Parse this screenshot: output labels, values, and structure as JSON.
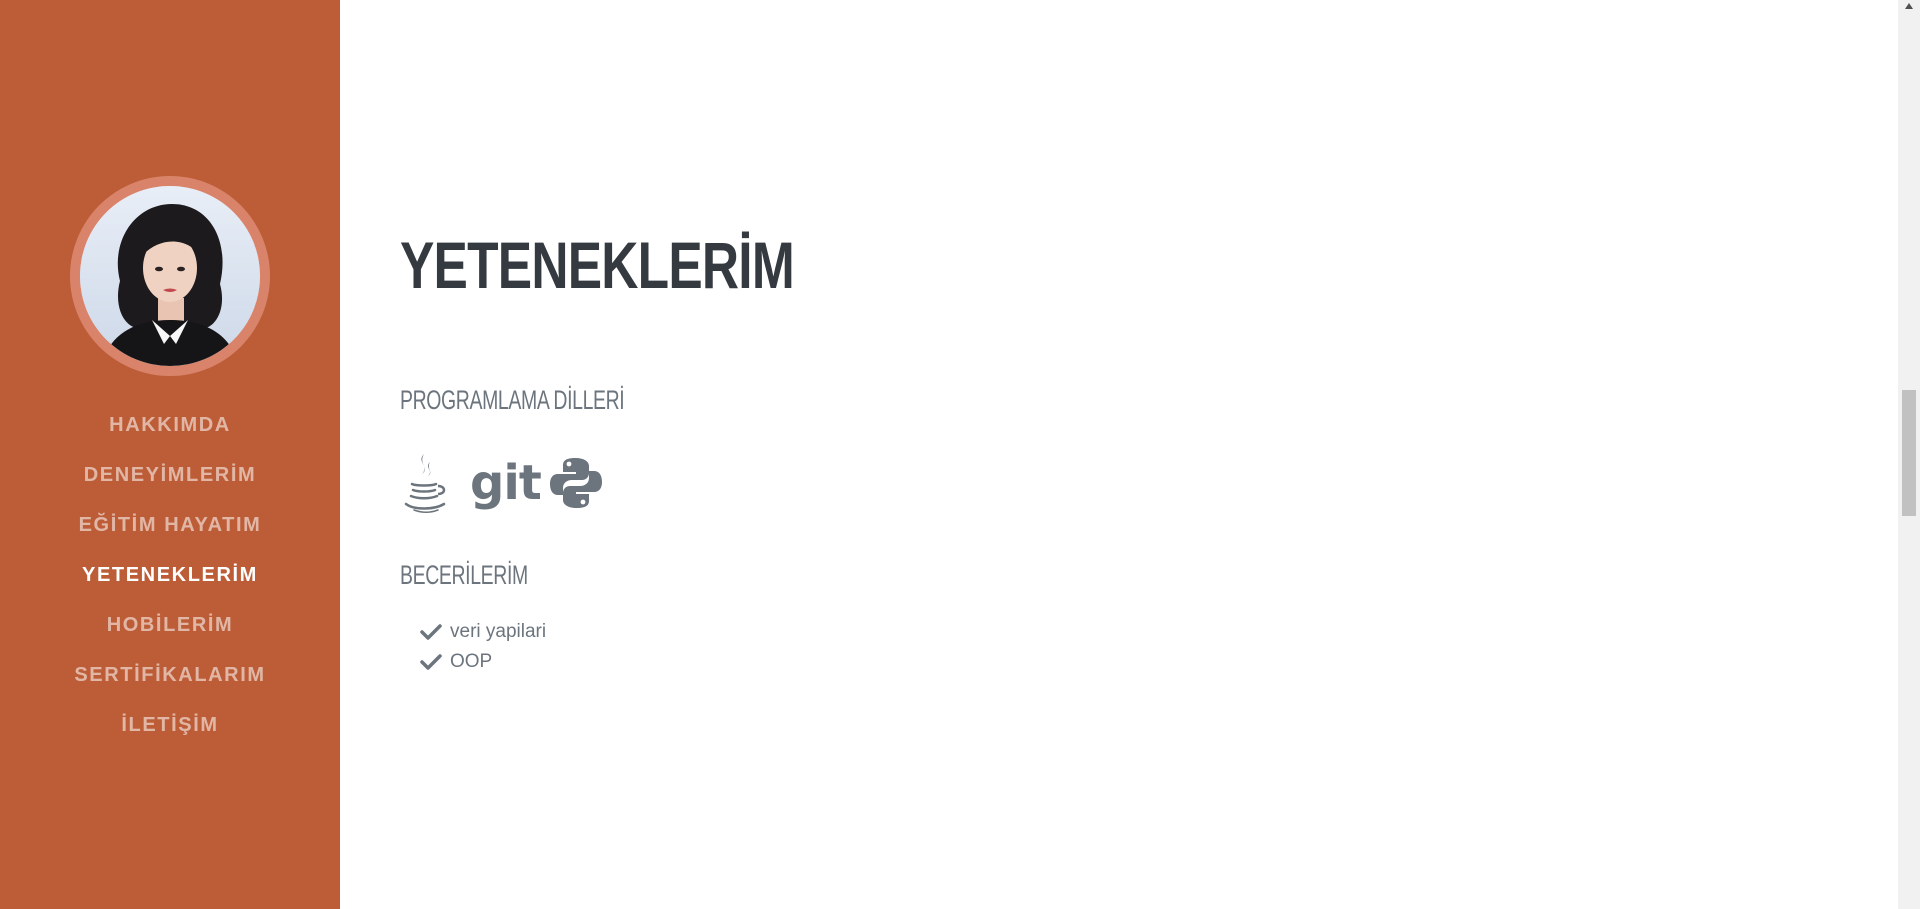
{
  "nav": {
    "items": [
      {
        "label": "HAKKIMDA"
      },
      {
        "label": "DENEYİMLERİM"
      },
      {
        "label": "EĞİTİM HAYATIM"
      },
      {
        "label": "YETENEKLERİM"
      },
      {
        "label": "HOBİLERİM"
      },
      {
        "label": "SERTİFİKALARIM"
      },
      {
        "label": "İLETİŞİM"
      }
    ],
    "active_index": 3
  },
  "section": {
    "title": "YETENEKLERİM",
    "languages_heading": "PROGRAMLAMA DİLLERİ",
    "language_icons": [
      "java-icon",
      "git-icon",
      "python-icon"
    ],
    "git_label": "git",
    "skills_heading": "BECERİLERİM",
    "skills": [
      "veri yapilari",
      "OOP"
    ]
  },
  "colors": {
    "sidebar_bg": "#bd5d38",
    "avatar_ring": "#d9846a",
    "heading": "#343a40",
    "muted_text": "#6c757d",
    "nav_active": "#ffffff",
    "nav_inactive": "rgba(255,255,255,0.55)"
  }
}
